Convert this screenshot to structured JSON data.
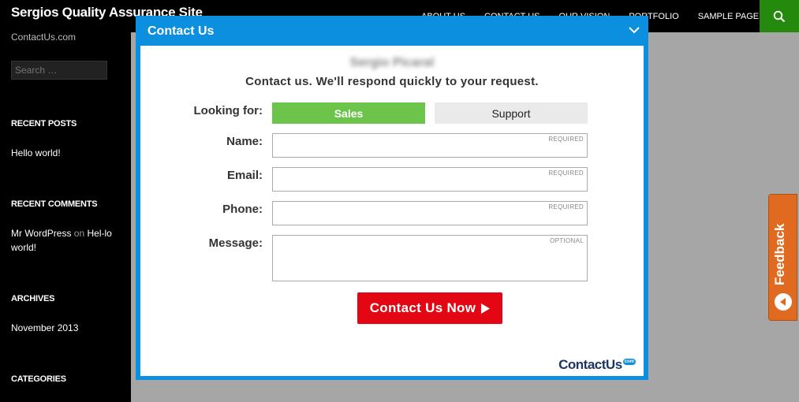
{
  "site": {
    "title": "Sergios Quality Assurance Site",
    "tagline": "ContactUs.com"
  },
  "nav": {
    "items": [
      "ABOUT US",
      "CONTACT US",
      "OUR VISION",
      "PORTFOLIO",
      "SAMPLE PAGE"
    ]
  },
  "sidebar": {
    "search_placeholder": "Search …",
    "recent_posts_title": "RECENT POSTS",
    "recent_post_1": "Hello world!",
    "recent_comments_title": "RECENT COMMENTS",
    "comment_author": "Mr WordPress",
    "comment_on": "on",
    "comment_post": "Hel-lo world!",
    "archives_title": "ARCHIVES",
    "archive_1": "November 2013",
    "categories_title": "CATEGORIES"
  },
  "modal": {
    "title": "Contact Us",
    "company": "Sergio Picaral",
    "subtitle": "Contact us. We'll respond quickly to your request.",
    "looking_for_label": "Looking for:",
    "options": {
      "sales": "Sales",
      "support": "Support",
      "selected": "Sales"
    },
    "fields": {
      "name_label": "Name:",
      "name_tag": "REQUIRED",
      "email_label": "Email:",
      "email_tag": "REQUIRED",
      "phone_label": "Phone:",
      "phone_tag": "REQUIRED",
      "message_label": "Message:",
      "message_tag": "OPTIONAL"
    },
    "submit_label": "Contact Us Now",
    "brand": "ContactUs",
    "brand_badge": "com"
  },
  "feedback": {
    "label": "Feedback"
  },
  "colors": {
    "accent_blue": "#0d8fe0",
    "sales_green": "#6cc44a",
    "submit_red": "#e30613",
    "feedback_orange": "#e06a1f",
    "search_green": "#24890d"
  }
}
